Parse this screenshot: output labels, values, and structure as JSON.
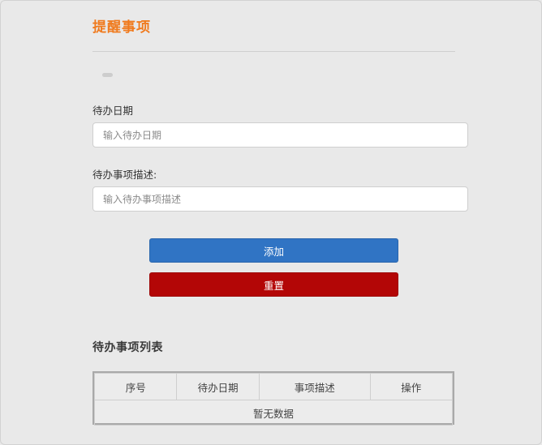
{
  "page": {
    "title": "提醒事项"
  },
  "form": {
    "date_label": "待办日期",
    "date_placeholder": "输入待办日期",
    "desc_label": "待办事项描述:",
    "desc_placeholder": "输入待办事项描述"
  },
  "buttons": {
    "add_label": "添加",
    "reset_label": "重置"
  },
  "list": {
    "title": "待办事项列表",
    "columns": [
      "序号",
      "待办日期",
      "事项描述",
      "操作"
    ],
    "empty_text": "暂无数据"
  },
  "colors": {
    "title": "#f07a1d",
    "add_button": "#3074c4",
    "reset_button": "#b30606",
    "background": "#e9e9e9"
  }
}
